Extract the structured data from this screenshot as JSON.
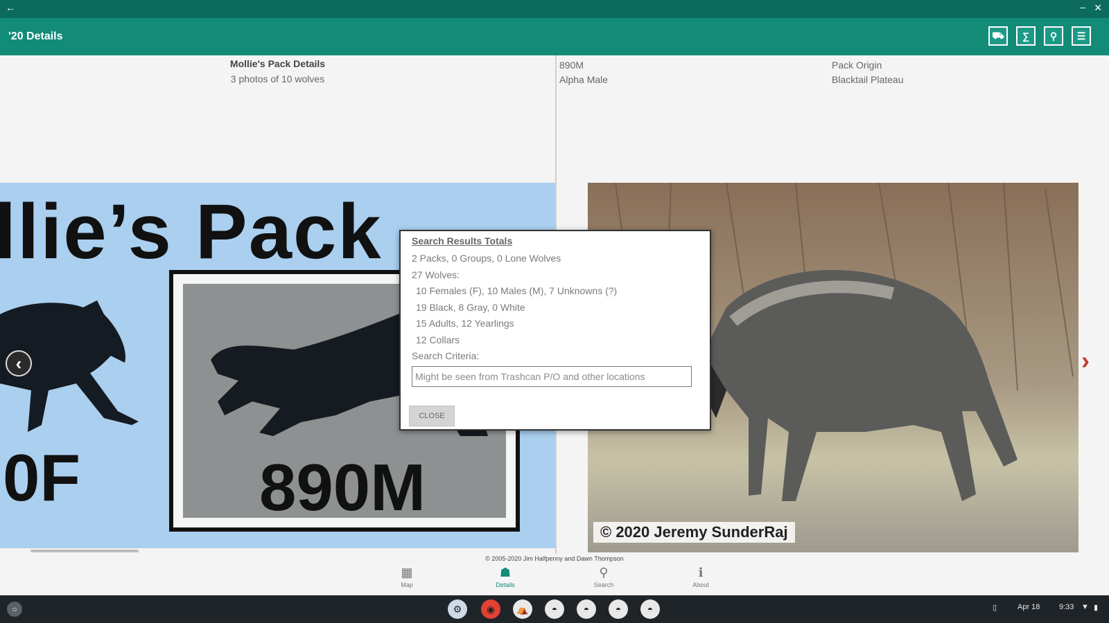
{
  "window": {
    "back_glyph": "←",
    "min_glyph": "–",
    "close_glyph": "✕"
  },
  "appbar": {
    "title": "'20 Details",
    "tools": [
      {
        "name": "map-tool-icon",
        "glyph": "⛟"
      },
      {
        "name": "sum-tool-icon",
        "glyph": "∑"
      },
      {
        "name": "search-tool-icon",
        "glyph": "⚲"
      },
      {
        "name": "list-tool-icon",
        "glyph": "☰"
      }
    ]
  },
  "left_panel": {
    "title": "Mollie's Pack Details",
    "subtitle": "3 photos of 10 wolves",
    "graphic": {
      "pack_text": "llie’s Pack",
      "wolf_code": "890M",
      "partial_code": "0F"
    },
    "prev_glyph": "‹"
  },
  "right_panel": {
    "wolf_id": "890M",
    "role": "Alpha Male",
    "origin_label": "Pack Origin",
    "origin_value": "Blacktail Plateau",
    "photo_credit": "© 2020 Jeremy SunderRaj",
    "next_glyph": "›"
  },
  "dialog": {
    "title": "Search Results Totals",
    "lines": [
      "2 Packs, 0 Groups, 0 Lone Wolves",
      "27 Wolves:",
      "10 Females (F), 10 Males (M), 7 Unknowns (?)",
      "19 Black, 8 Gray, 0 White",
      "15 Adults, 12 Yearlings",
      "12 Collars",
      "Search Criteria:"
    ],
    "criteria_value": "Might be seen from Trashcan P/O and other locations",
    "close_label": "CLOSE"
  },
  "footer": {
    "copyright": "© 2005-2020 Jim Halfpenny and Dawn Thompson"
  },
  "bottom_nav": [
    {
      "label": "Map",
      "glyph": "▦"
    },
    {
      "label": "Details",
      "glyph": "☗"
    },
    {
      "label": "Search",
      "glyph": "⚲"
    },
    {
      "label": "About",
      "glyph": "ℹ"
    }
  ],
  "shelf": {
    "launcher_glyph": "○",
    "date": "Apr 18",
    "time": "9:33",
    "wifi_glyph": "▼",
    "battery_glyph": "▮",
    "phone_glyph": "▯",
    "apps": [
      {
        "glyph": "⚙",
        "color": "#cfd8e6"
      },
      {
        "glyph": "◉",
        "color": "#e34133"
      },
      {
        "glyph": "⛺",
        "color": "#e8e8e8"
      },
      {
        "glyph": "◓",
        "color": "#e8e8e8"
      },
      {
        "glyph": "◓",
        "color": "#e8e8e8"
      },
      {
        "glyph": "◓",
        "color": "#e8e8e8"
      },
      {
        "glyph": "◓",
        "color": "#e8e8e8"
      }
    ]
  },
  "colors": {
    "header": "#138b79",
    "window_strip": "#0c6b5d",
    "shelf": "#1f2428",
    "accent_next": "#c43d2b"
  }
}
